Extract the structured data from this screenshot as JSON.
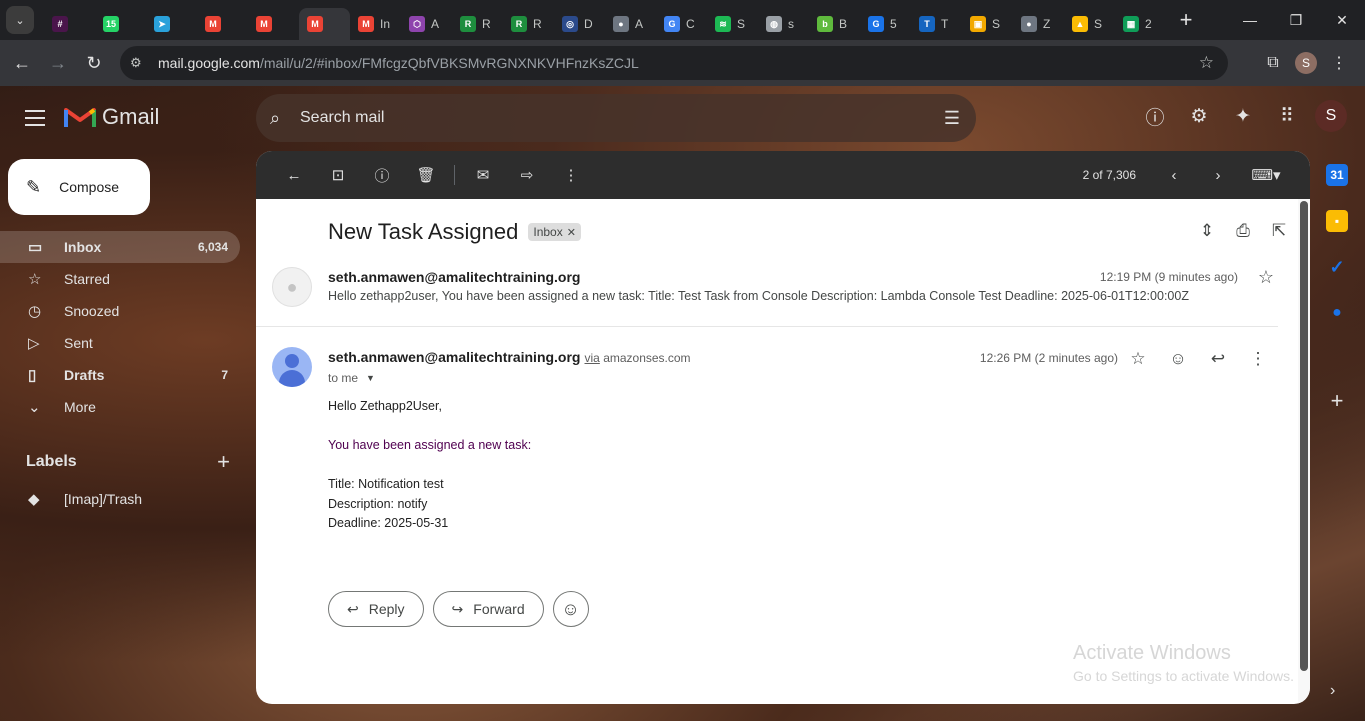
{
  "browser": {
    "tabs": [
      {
        "icon": "slack-icon",
        "label": "",
        "color": "#4a154b"
      },
      {
        "icon": "whatsapp-icon",
        "label": "",
        "color": "#25d366",
        "badge": "15"
      },
      {
        "icon": "telegram-icon",
        "label": "",
        "color": "#2aa1da"
      },
      {
        "icon": "gmail-icon",
        "label": "",
        "color": "#ea4335"
      },
      {
        "icon": "gmail-icon",
        "label": "",
        "color": "#ea4335"
      },
      {
        "icon": "gmail-icon",
        "label": "",
        "color": "#ea4335",
        "active": true
      },
      {
        "icon": "gmail-icon",
        "label": "In",
        "color": "#ea4335"
      },
      {
        "icon": "cube-icon",
        "label": "A",
        "color": "#8e44ad"
      },
      {
        "icon": "ext-icon",
        "label": "R",
        "color": "#1e8e3e"
      },
      {
        "icon": "ext-icon",
        "label": "R",
        "color": "#1e8e3e"
      },
      {
        "icon": "eye-icon",
        "label": "D",
        "color": "#2b4a8b"
      },
      {
        "icon": "github-icon",
        "label": "A",
        "color": "#6e7681"
      },
      {
        "icon": "g-icon",
        "label": "C",
        "color": "#4285f4"
      },
      {
        "icon": "spotify-icon",
        "label": "S",
        "color": "#1db954"
      },
      {
        "icon": "globe-icon",
        "label": "s",
        "color": "#9aa0a6"
      },
      {
        "icon": "bitbucket-icon",
        "label": "B",
        "color": "#5fba3d"
      },
      {
        "icon": "grammarly-icon",
        "label": "5",
        "color": "#1a73e8"
      },
      {
        "icon": "t-icon",
        "label": "T",
        "color": "#1565c0"
      },
      {
        "icon": "box-icon",
        "label": "S",
        "color": "#f2a900"
      },
      {
        "icon": "github-icon",
        "label": "Z",
        "color": "#6e7681"
      },
      {
        "icon": "drive-icon",
        "label": "S",
        "color": "#fbbc04"
      },
      {
        "icon": "sheets-icon",
        "label": "2",
        "color": "#0f9d58"
      }
    ],
    "url_host": "mail.google.com",
    "url_path": "/mail/u/2/#inbox/FMfcgzQbfVBKSMvRGNXNKVHFnzKsZCJL",
    "profile_initial": "S"
  },
  "gmail": {
    "logo_text": "Gmail",
    "search_placeholder": "Search mail",
    "account_initial": "S",
    "compose_label": "Compose",
    "nav": [
      {
        "label": "Inbox",
        "count": "6,034",
        "icon": "inbox-icon",
        "glyph": "▭",
        "active": true
      },
      {
        "label": "Starred",
        "count": "",
        "icon": "star-icon",
        "glyph": "☆"
      },
      {
        "label": "Snoozed",
        "count": "",
        "icon": "clock-icon",
        "glyph": "◷"
      },
      {
        "label": "Sent",
        "count": "",
        "icon": "send-icon",
        "glyph": "▷"
      },
      {
        "label": "Drafts",
        "count": "7",
        "icon": "draft-icon",
        "glyph": "▯"
      },
      {
        "label": "More",
        "count": "",
        "icon": "chevron-down-icon",
        "glyph": "⌄"
      }
    ],
    "labels_title": "Labels",
    "labels": [
      {
        "label": "[Imap]/Trash"
      }
    ],
    "pager": "2 of 7,306"
  },
  "thread": {
    "subject": "New Task Assigned",
    "chip": "Inbox",
    "message1": {
      "sender": "seth.anmawen@amalitechtraining.org",
      "time": "12:19 PM (9 minutes ago)",
      "snippet": "Hello zethapp2user, You have been assigned a new task: Title: Test Task from Console Description: Lambda Console Test Deadline: 2025-06-01T12:00:00Z"
    },
    "message2": {
      "sender": "seth.anmawen@amalitechtraining.org",
      "via_word": "via",
      "via_domain": "amazonses.com",
      "to": "to me",
      "time": "12:26 PM (2 minutes ago)",
      "greeting": "Hello Zethapp2User,",
      "intro": "You have been assigned a new task:",
      "title_line": "Title: Notification test",
      "description_line": "Description: notify",
      "deadline_line": "Deadline: 2025-05-31"
    },
    "reply_label": "Reply",
    "forward_label": "Forward"
  },
  "watermark": {
    "title": "Activate Windows",
    "subtitle": "Go to Settings to activate Windows."
  },
  "colors": {
    "gmail_red": "#ea4335",
    "accent_blue": "#4b6fd6",
    "purple_text": "#500050"
  }
}
